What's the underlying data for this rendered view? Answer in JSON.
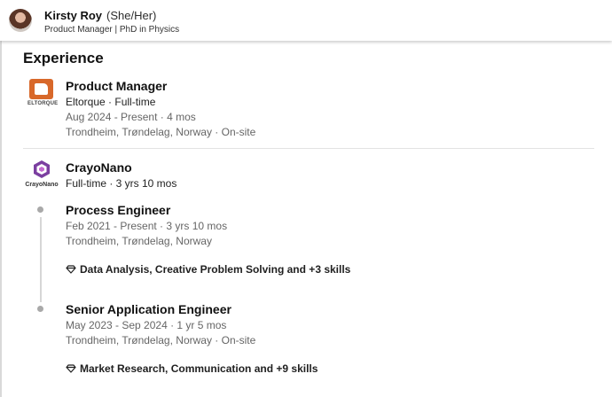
{
  "profile": {
    "name": "Kirsty Roy",
    "pronouns": "(She/Her)",
    "headline": "Product Manager | PhD in Physics"
  },
  "section": {
    "title": "Experience"
  },
  "experiences": [
    {
      "company_logo_text": "ELTORQUE",
      "title": "Product Manager",
      "company_type": "Eltorque · Full-time",
      "dates": "Aug 2024 - Present · 4 mos",
      "location": "Trondheim, Trøndelag, Norway · On-site"
    },
    {
      "company_logo_text": "CrayoNano",
      "company": "CrayoNano",
      "employment": "Full-time · 3 yrs 10 mos",
      "roles": [
        {
          "title": "Process Engineer",
          "dates": "Feb 2021 - Present · 3 yrs 10 mos",
          "location": "Trondheim, Trøndelag, Norway",
          "skills": "Data Analysis, Creative Problem Solving and +3 skills"
        },
        {
          "title": "Senior Application Engineer",
          "dates": "May 2023 - Sep 2024 · 1 yr 5 mos",
          "location": "Trondheim, Trøndelag, Norway · On-site",
          "skills": "Market Research, Communication and +9 skills"
        }
      ]
    }
  ],
  "colors": {
    "eltorque_brand": "#d8682a",
    "crayonano_brand": "#7b3fa0",
    "timeline": "#a9a9a9"
  }
}
